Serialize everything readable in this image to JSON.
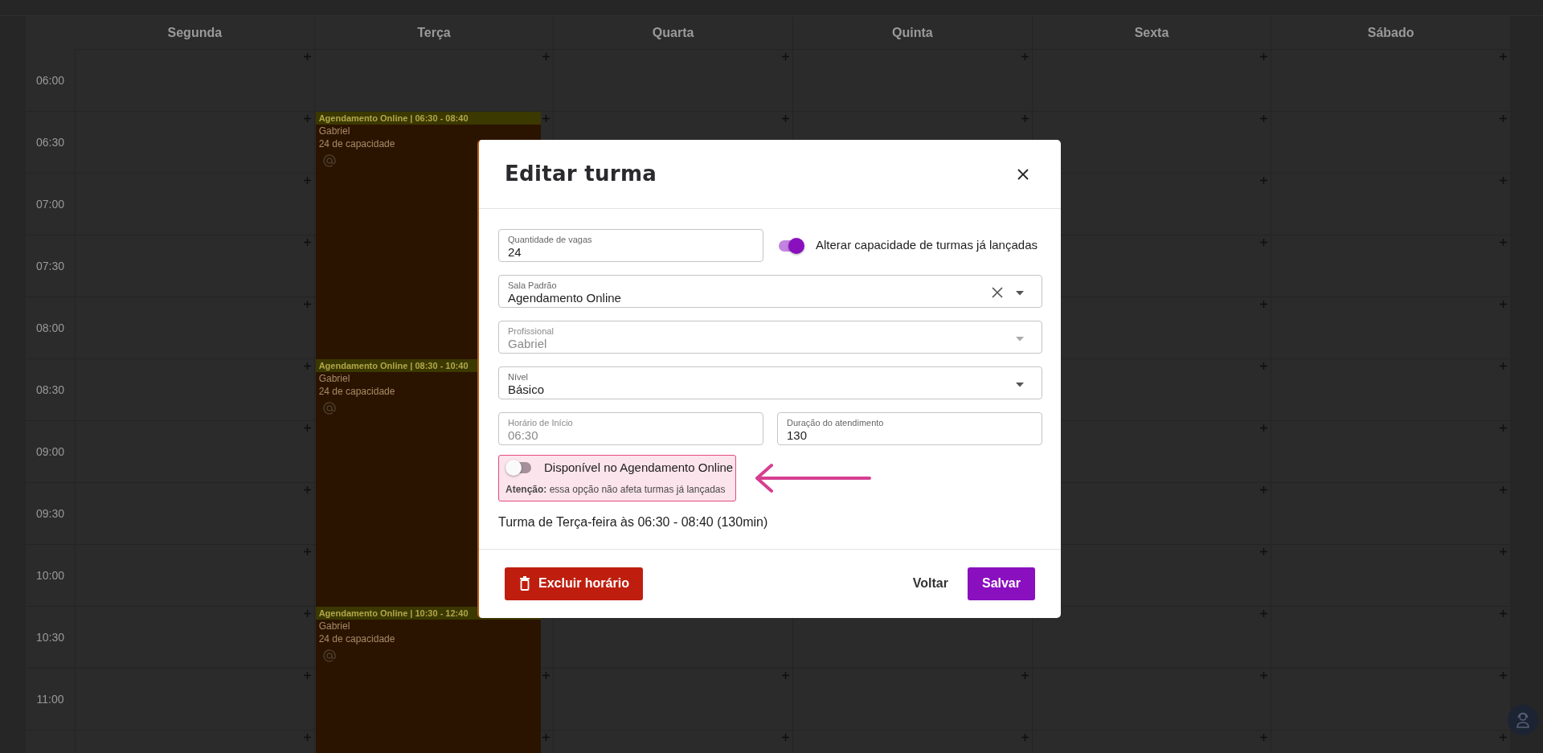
{
  "calendar": {
    "days": [
      {
        "label": "Segunda"
      },
      {
        "label": "Terça",
        "events": [
          {
            "title": "Agendamento Online | 06:30 - 08:40",
            "professional": "Gabriel",
            "capacity": "24 de capacidade"
          },
          {
            "title": "Agendamento Online | 08:30 - 10:40",
            "professional": "Gabriel",
            "capacity": "24 de capacidade"
          },
          {
            "title": "Agendamento Online | 10:30 - 12:40",
            "professional": "Gabriel",
            "capacity": "24 de capacidade"
          }
        ]
      },
      {
        "label": "Quarta"
      },
      {
        "label": "Quinta"
      },
      {
        "label": "Sexta"
      },
      {
        "label": "Sábado"
      }
    ],
    "times": [
      "06:00",
      "06:30",
      "07:00",
      "07:30",
      "08:00",
      "08:30",
      "09:00",
      "09:30",
      "10:00",
      "10:30",
      "11:00"
    ]
  },
  "modal": {
    "title": "Editar turma",
    "vagas": {
      "label": "Quantidade de vagas",
      "value": "24"
    },
    "capacity_toggle": {
      "label": "Alterar capacidade de turmas já lançadas",
      "on": true
    },
    "sala": {
      "label": "Sala Padrão",
      "value": "Agendamento Online",
      "clearable": true,
      "disabled": false
    },
    "profissional": {
      "label": "Profissional",
      "value": "Gabriel",
      "disabled": true
    },
    "nivel": {
      "label": "Nível",
      "value": "Básico",
      "disabled": false
    },
    "horario": {
      "label": "Horário de Início",
      "value": "06:30",
      "disabled": true
    },
    "duracao": {
      "label": "Duração do atendimento",
      "value": "130",
      "disabled": false
    },
    "online_toggle": {
      "label": "Disponível no Agendamento Online",
      "on": false,
      "note": "**Atenção:** essa opção não afeta turmas já lançadas"
    },
    "summary": "Turma de Terça-feira às 06:30 - 08:40 (130min)",
    "buttons": {
      "delete": "Excluir horário",
      "back": "Voltar",
      "save": "Salvar"
    }
  }
}
